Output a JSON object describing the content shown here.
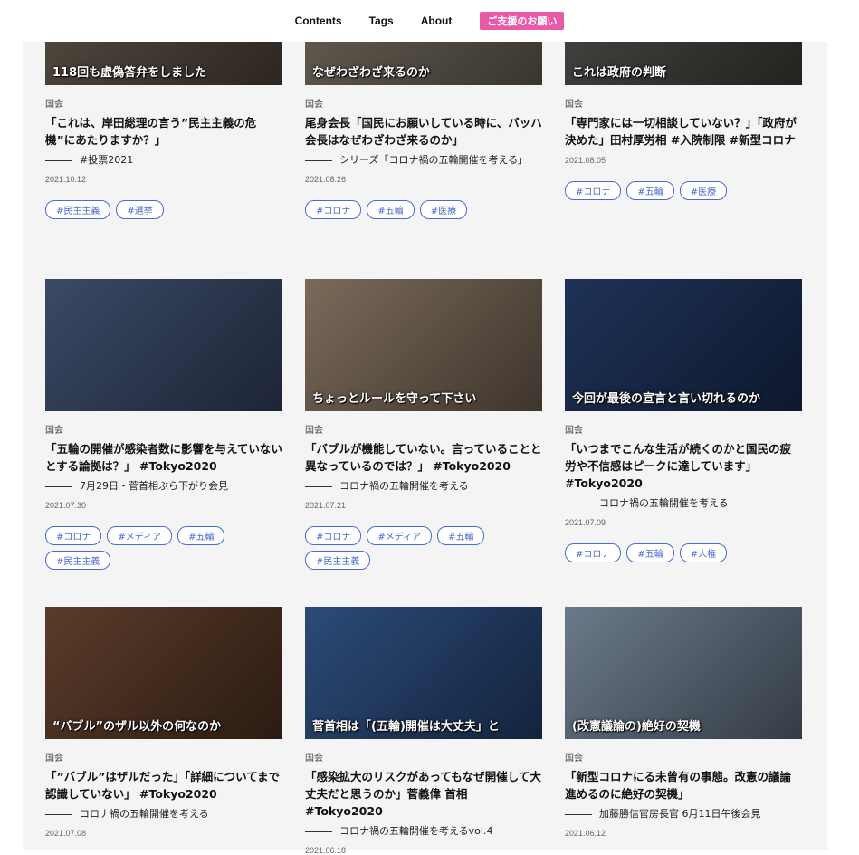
{
  "nav": {
    "contents": "Contents",
    "tags": "Tags",
    "about": "About",
    "support": "ご支援のお願い"
  },
  "colors": {
    "accent": "#e85aa8",
    "tag": "#4a6bd1",
    "background": "#f4f4f4"
  },
  "cards": [
    {
      "category": "国会",
      "title": "「これは、岸田総理の言う”民主主義の危機”にあたりますか？」",
      "series": "#投票2021",
      "date": "2021.10.12",
      "thumb_text": "118回も虚偽答弁をしました",
      "tags": [
        "#民主主義",
        "#選挙"
      ]
    },
    {
      "category": "国会",
      "title": "尾身会長「国民にお願いしている時に、バッハ会長はなぜわざわざ来るのか」",
      "series": "シリーズ「コロナ禍の五輪開催を考える」",
      "date": "2021.08.26",
      "thumb_text": "なぜわざわざ来るのか",
      "tags": [
        "#コロナ",
        "#五輪",
        "#医療"
      ]
    },
    {
      "category": "国会",
      "title": "「専門家には一切相談していない？」「政府が決めた」田村厚労相 #入院制限 #新型コロナ",
      "series": "",
      "date": "2021.08.05",
      "thumb_text": "これは政府の判断",
      "tags": [
        "#コロナ",
        "#五輪",
        "#医療"
      ]
    },
    {
      "category": "国会",
      "title": "「五輪の開催が感染者数に影響を与えていないとする論拠は？」 #Tokyo2020",
      "series": "7月29日・菅首相ぶら下がり会見",
      "date": "2021.07.30",
      "thumb_text": "",
      "tags": [
        "#コロナ",
        "#メディア",
        "#五輪",
        "#民主主義"
      ]
    },
    {
      "category": "国会",
      "title": "「バブルが機能していない。言っていることと異なっているのでは？」 #Tokyo2020",
      "series": "コロナ禍の五輪開催を考える",
      "date": "2021.07.21",
      "thumb_text": "ちょっとルールを守って下さい",
      "tags": [
        "#コロナ",
        "#メディア",
        "#五輪",
        "#民主主義"
      ]
    },
    {
      "category": "国会",
      "title": "「いつまでこんな生活が続くのかと国民の疲労や不信感はピークに達しています」 #Tokyo2020",
      "series": "コロナ禍の五輪開催を考える",
      "date": "2021.07.09",
      "thumb_text": "今回が最後の宣言と言い切れるのか",
      "tags": [
        "#コロナ",
        "#五輪",
        "#人権"
      ]
    },
    {
      "category": "国会",
      "title": "「”バブル”はザルだった」「詳細についてまで認識していない」 #Tokyo2020",
      "series": "コロナ禍の五輪開催を考える",
      "date": "2021.07.08",
      "thumb_text": "“バブル”のザル以外の何なのか",
      "tags": []
    },
    {
      "category": "国会",
      "title": "「感染拡大のリスクがあってもなぜ開催して大丈夫だと思うのか」菅義偉 首相 #Tokyo2020",
      "series": "コロナ禍の五輪開催を考えるvol.4",
      "date": "2021.06.18",
      "thumb_text": "菅首相は「(五輪)開催は大丈夫」と",
      "tags": []
    },
    {
      "category": "国会",
      "title": "「新型コロナにる未曾有の事態。改憲の議論進めるのに絶好の契機」",
      "series": "加藤勝信官房長官 6月11日午後会見",
      "date": "2021.06.12",
      "thumb_text": "(改憲議論の)絶好の契機",
      "tags": []
    }
  ]
}
